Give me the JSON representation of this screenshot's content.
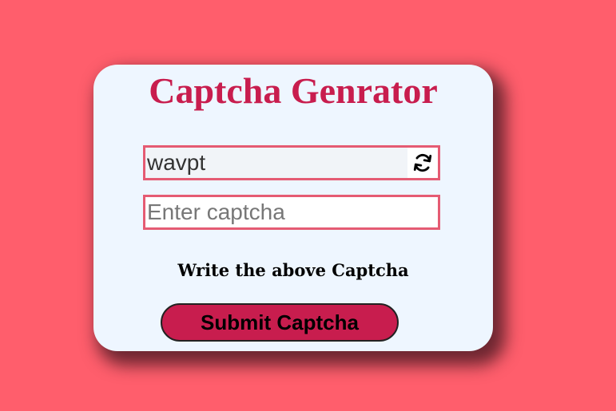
{
  "title": "Captcha Genrator",
  "captcha": {
    "value": "wavpt",
    "refresh_icon": "refresh-icon"
  },
  "input": {
    "placeholder": "Enter captcha",
    "value": ""
  },
  "hint": "Write the above Captcha",
  "submit_label": "Submit Captcha",
  "colors": {
    "background": "#ff5e6c",
    "card": "#eef6ff",
    "accent": "#c81d4e",
    "border": "#e55b73"
  }
}
